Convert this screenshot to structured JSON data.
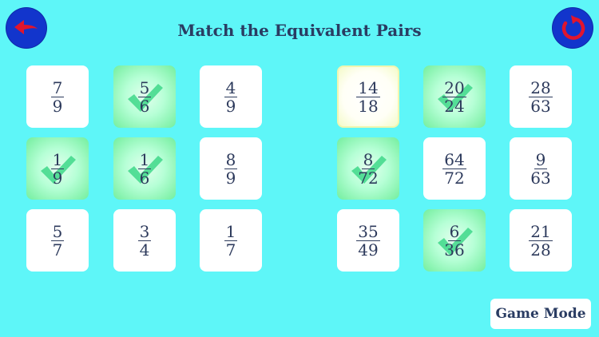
{
  "header": {
    "title": "Match the Equivalent Pairs",
    "back_icon": "back-arrow-icon",
    "reset_icon": "restart-icon",
    "button_color": "#1235cc",
    "icon_color": "#e0152e"
  },
  "left_cards": [
    {
      "num": "7",
      "den": "9",
      "state": "normal"
    },
    {
      "num": "5",
      "den": "6",
      "state": "matched"
    },
    {
      "num": "4",
      "den": "9",
      "state": "normal"
    },
    {
      "num": "1",
      "den": "9",
      "state": "matched"
    },
    {
      "num": "1",
      "den": "6",
      "state": "matched"
    },
    {
      "num": "8",
      "den": "9",
      "state": "normal"
    },
    {
      "num": "5",
      "den": "7",
      "state": "normal"
    },
    {
      "num": "3",
      "den": "4",
      "state": "normal"
    },
    {
      "num": "1",
      "den": "7",
      "state": "normal"
    }
  ],
  "right_cards": [
    {
      "num": "14",
      "den": "18",
      "state": "selected"
    },
    {
      "num": "20",
      "den": "24",
      "state": "matched"
    },
    {
      "num": "28",
      "den": "63",
      "state": "normal"
    },
    {
      "num": "8",
      "den": "72",
      "state": "matched"
    },
    {
      "num": "64",
      "den": "72",
      "state": "normal"
    },
    {
      "num": "9",
      "den": "63",
      "state": "normal"
    },
    {
      "num": "35",
      "den": "49",
      "state": "normal"
    },
    {
      "num": "6",
      "den": "36",
      "state": "matched"
    },
    {
      "num": "21",
      "den": "28",
      "state": "normal"
    }
  ],
  "footer": {
    "mode_label": "Game Mode"
  },
  "colors": {
    "background": "#5ef6f8",
    "matched": "#73ee9e",
    "check": "#3fd98a",
    "text": "#2d3a5c"
  }
}
